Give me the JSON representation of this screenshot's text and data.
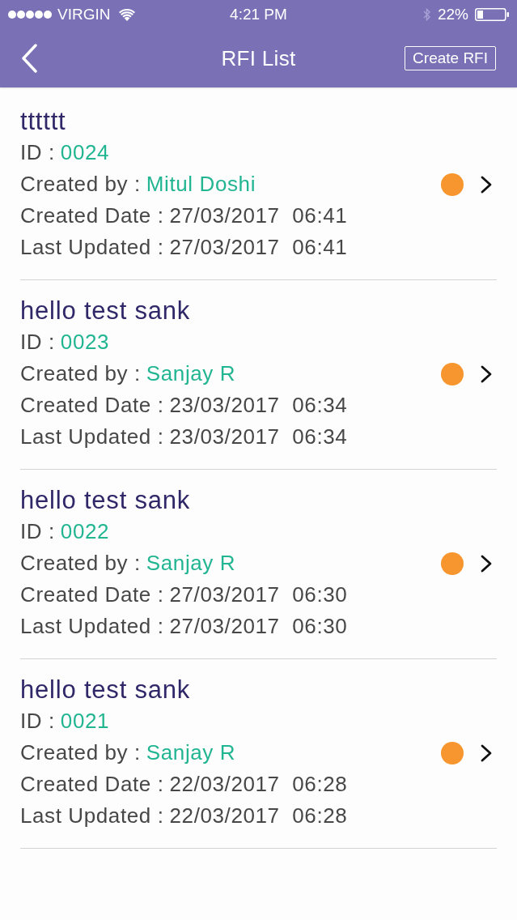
{
  "status_bar": {
    "carrier": "VIRGIN",
    "time": "4:21 PM",
    "battery": "22%"
  },
  "nav_bar": {
    "title": "RFI List",
    "action": "Create RFI"
  },
  "rfis": [
    {
      "title": "tttttt",
      "color": "#f7952f",
      "fields": [
        {
          "label": "ID :",
          "value": "0024",
          "kind": "accent"
        },
        {
          "label": "Created by :",
          "value": "Mitul Doshi",
          "kind": "accent"
        },
        {
          "label": "Created Date :",
          "value": "27/03/2017  06:41",
          "kind": "plain"
        },
        {
          "label": "Last Updated :",
          "value": "27/03/2017  06:41",
          "kind": "plain"
        }
      ]
    },
    {
      "title": "hello test sank",
      "color": "#f7952f",
      "fields": [
        {
          "label": "ID :",
          "value": "0023",
          "kind": "accent"
        },
        {
          "label": "Created by :",
          "value": "Sanjay R",
          "kind": "accent"
        },
        {
          "label": "Created Date :",
          "value": "23/03/2017  06:34",
          "kind": "plain"
        },
        {
          "label": "Last Updated :",
          "value": "23/03/2017  06:34",
          "kind": "plain"
        }
      ]
    },
    {
      "title": "hello test sank",
      "color": "#f7952f",
      "fields": [
        {
          "label": "ID :",
          "value": "0022",
          "kind": "accent"
        },
        {
          "label": "Created by :",
          "value": "Sanjay R",
          "kind": "accent"
        },
        {
          "label": "Created Date :",
          "value": "27/03/2017  06:30",
          "kind": "plain"
        },
        {
          "label": "Last Updated :",
          "value": "27/03/2017  06:30",
          "kind": "plain"
        }
      ]
    },
    {
      "title": "hello test sank",
      "color": "#f7952f",
      "fields": [
        {
          "label": "ID :",
          "value": "0021",
          "kind": "accent"
        },
        {
          "label": "Created by :",
          "value": "Sanjay R",
          "kind": "accent"
        },
        {
          "label": "Created Date :",
          "value": "22/03/2017  06:28",
          "kind": "plain"
        },
        {
          "label": "Last Updated :",
          "value": "22/03/2017  06:28",
          "kind": "plain"
        }
      ]
    }
  ]
}
